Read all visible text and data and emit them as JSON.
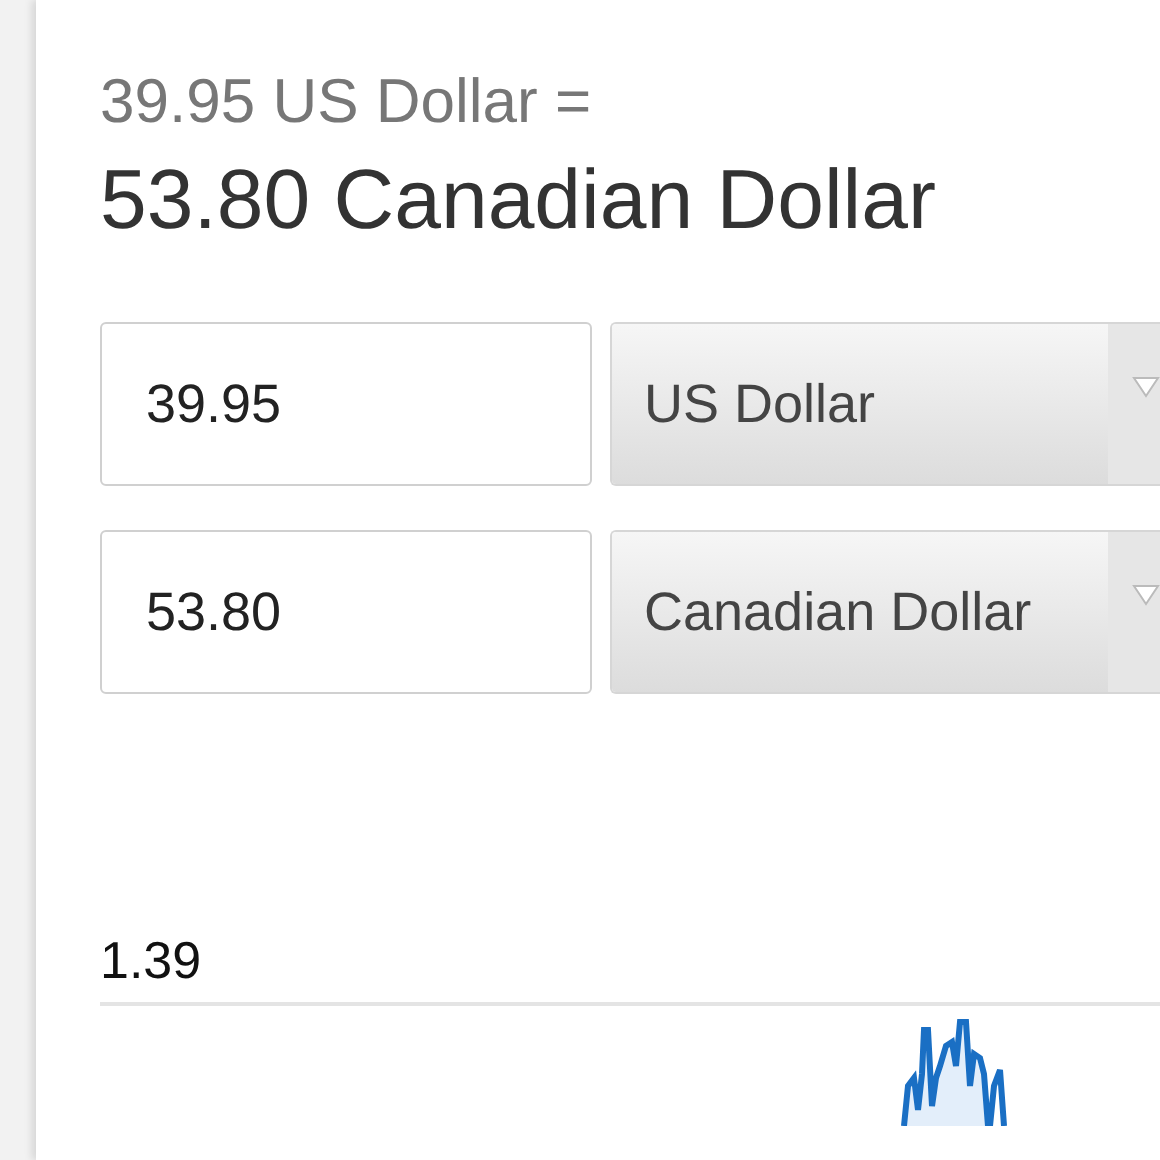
{
  "conversion": {
    "from_text": "39.95 US Dollar =",
    "result_text": "53.80 Canadian Dollar"
  },
  "converters": [
    {
      "amount": "39.95",
      "currency": "US Dollar"
    },
    {
      "amount": "53.80",
      "currency": "Canadian Dollar"
    }
  ],
  "chart": {
    "top_label": "1.39"
  }
}
